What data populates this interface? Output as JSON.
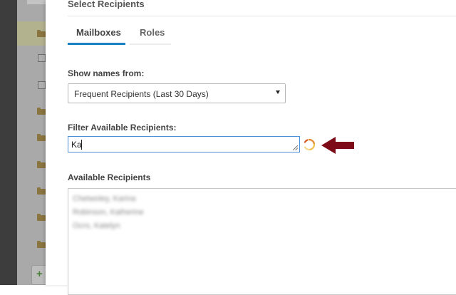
{
  "dialog": {
    "title": "Select Recipients",
    "tabs": [
      {
        "label": "Mailboxes",
        "active": true
      },
      {
        "label": "Roles",
        "active": false
      }
    ],
    "show_names_label": "Show names from:",
    "show_names_select": {
      "value": "Frequent Recipients (Last 30 Days)"
    },
    "filter_label": "Filter Available Recipients:",
    "filter_input": {
      "value": "Ka"
    },
    "available_label": "Available Recipients",
    "available_list": [
      {
        "label": "Chetwoley, Karina"
      },
      {
        "label": "Robinson, Katherine"
      },
      {
        "label": "Ocro, Katelyn"
      }
    ]
  },
  "icons": {
    "loading": "loading-spinner-icon",
    "arrow": "left-arrow-icon",
    "folder": "folder-icon",
    "add": "plus-icon"
  },
  "colors": {
    "accent": "#1b7fc4",
    "arrow": "#7d0a17",
    "spinner": "#e58a2a"
  }
}
